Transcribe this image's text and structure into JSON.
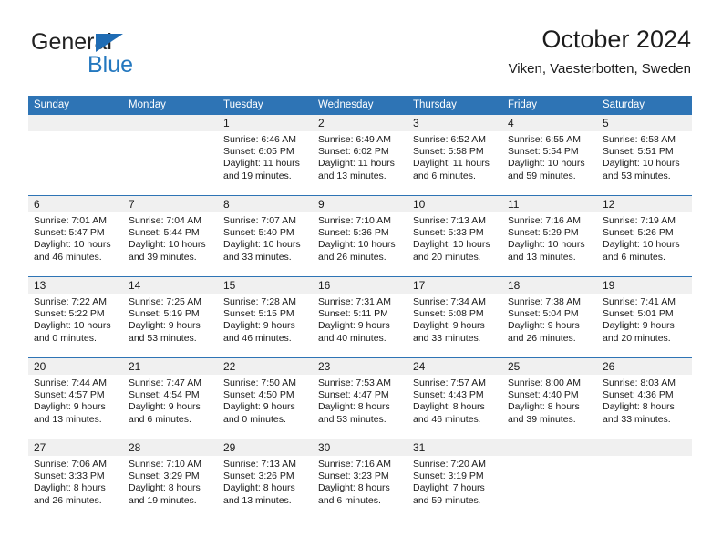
{
  "brand": {
    "name_part1": "General",
    "name_part2": "Blue",
    "accent_color": "#2478bf",
    "triangle_color": "#1f6cb4"
  },
  "header": {
    "title": "October 2024",
    "subtitle": "Viken, Vaesterbotten, Sweden"
  },
  "theme": {
    "header_row_bg": "#2e74b5",
    "daynum_band_bg": "#f0f0f0",
    "grid_line": "#2e74b5",
    "text": "#1a1a1a"
  },
  "calendar": {
    "weekday_headers": [
      "Sunday",
      "Monday",
      "Tuesday",
      "Wednesday",
      "Thursday",
      "Friday",
      "Saturday"
    ],
    "labels": {
      "sunrise": "Sunrise:",
      "sunset": "Sunset:",
      "daylight": "Daylight:"
    },
    "weeks": [
      [
        {
          "day": "",
          "empty": true
        },
        {
          "day": "",
          "empty": true
        },
        {
          "day": "1",
          "sunrise": "Sunrise: 6:46 AM",
          "sunset": "Sunset: 6:05 PM",
          "daylight_1": "Daylight: 11 hours",
          "daylight_2": "and 19 minutes."
        },
        {
          "day": "2",
          "sunrise": "Sunrise: 6:49 AM",
          "sunset": "Sunset: 6:02 PM",
          "daylight_1": "Daylight: 11 hours",
          "daylight_2": "and 13 minutes."
        },
        {
          "day": "3",
          "sunrise": "Sunrise: 6:52 AM",
          "sunset": "Sunset: 5:58 PM",
          "daylight_1": "Daylight: 11 hours",
          "daylight_2": "and 6 minutes."
        },
        {
          "day": "4",
          "sunrise": "Sunrise: 6:55 AM",
          "sunset": "Sunset: 5:54 PM",
          "daylight_1": "Daylight: 10 hours",
          "daylight_2": "and 59 minutes."
        },
        {
          "day": "5",
          "sunrise": "Sunrise: 6:58 AM",
          "sunset": "Sunset: 5:51 PM",
          "daylight_1": "Daylight: 10 hours",
          "daylight_2": "and 53 minutes."
        }
      ],
      [
        {
          "day": "6",
          "sunrise": "Sunrise: 7:01 AM",
          "sunset": "Sunset: 5:47 PM",
          "daylight_1": "Daylight: 10 hours",
          "daylight_2": "and 46 minutes."
        },
        {
          "day": "7",
          "sunrise": "Sunrise: 7:04 AM",
          "sunset": "Sunset: 5:44 PM",
          "daylight_1": "Daylight: 10 hours",
          "daylight_2": "and 39 minutes."
        },
        {
          "day": "8",
          "sunrise": "Sunrise: 7:07 AM",
          "sunset": "Sunset: 5:40 PM",
          "daylight_1": "Daylight: 10 hours",
          "daylight_2": "and 33 minutes."
        },
        {
          "day": "9",
          "sunrise": "Sunrise: 7:10 AM",
          "sunset": "Sunset: 5:36 PM",
          "daylight_1": "Daylight: 10 hours",
          "daylight_2": "and 26 minutes."
        },
        {
          "day": "10",
          "sunrise": "Sunrise: 7:13 AM",
          "sunset": "Sunset: 5:33 PM",
          "daylight_1": "Daylight: 10 hours",
          "daylight_2": "and 20 minutes."
        },
        {
          "day": "11",
          "sunrise": "Sunrise: 7:16 AM",
          "sunset": "Sunset: 5:29 PM",
          "daylight_1": "Daylight: 10 hours",
          "daylight_2": "and 13 minutes."
        },
        {
          "day": "12",
          "sunrise": "Sunrise: 7:19 AM",
          "sunset": "Sunset: 5:26 PM",
          "daylight_1": "Daylight: 10 hours",
          "daylight_2": "and 6 minutes."
        }
      ],
      [
        {
          "day": "13",
          "sunrise": "Sunrise: 7:22 AM",
          "sunset": "Sunset: 5:22 PM",
          "daylight_1": "Daylight: 10 hours",
          "daylight_2": "and 0 minutes."
        },
        {
          "day": "14",
          "sunrise": "Sunrise: 7:25 AM",
          "sunset": "Sunset: 5:19 PM",
          "daylight_1": "Daylight: 9 hours",
          "daylight_2": "and 53 minutes."
        },
        {
          "day": "15",
          "sunrise": "Sunrise: 7:28 AM",
          "sunset": "Sunset: 5:15 PM",
          "daylight_1": "Daylight: 9 hours",
          "daylight_2": "and 46 minutes."
        },
        {
          "day": "16",
          "sunrise": "Sunrise: 7:31 AM",
          "sunset": "Sunset: 5:11 PM",
          "daylight_1": "Daylight: 9 hours",
          "daylight_2": "and 40 minutes."
        },
        {
          "day": "17",
          "sunrise": "Sunrise: 7:34 AM",
          "sunset": "Sunset: 5:08 PM",
          "daylight_1": "Daylight: 9 hours",
          "daylight_2": "and 33 minutes."
        },
        {
          "day": "18",
          "sunrise": "Sunrise: 7:38 AM",
          "sunset": "Sunset: 5:04 PM",
          "daylight_1": "Daylight: 9 hours",
          "daylight_2": "and 26 minutes."
        },
        {
          "day": "19",
          "sunrise": "Sunrise: 7:41 AM",
          "sunset": "Sunset: 5:01 PM",
          "daylight_1": "Daylight: 9 hours",
          "daylight_2": "and 20 minutes."
        }
      ],
      [
        {
          "day": "20",
          "sunrise": "Sunrise: 7:44 AM",
          "sunset": "Sunset: 4:57 PM",
          "daylight_1": "Daylight: 9 hours",
          "daylight_2": "and 13 minutes."
        },
        {
          "day": "21",
          "sunrise": "Sunrise: 7:47 AM",
          "sunset": "Sunset: 4:54 PM",
          "daylight_1": "Daylight: 9 hours",
          "daylight_2": "and 6 minutes."
        },
        {
          "day": "22",
          "sunrise": "Sunrise: 7:50 AM",
          "sunset": "Sunset: 4:50 PM",
          "daylight_1": "Daylight: 9 hours",
          "daylight_2": "and 0 minutes."
        },
        {
          "day": "23",
          "sunrise": "Sunrise: 7:53 AM",
          "sunset": "Sunset: 4:47 PM",
          "daylight_1": "Daylight: 8 hours",
          "daylight_2": "and 53 minutes."
        },
        {
          "day": "24",
          "sunrise": "Sunrise: 7:57 AM",
          "sunset": "Sunset: 4:43 PM",
          "daylight_1": "Daylight: 8 hours",
          "daylight_2": "and 46 minutes."
        },
        {
          "day": "25",
          "sunrise": "Sunrise: 8:00 AM",
          "sunset": "Sunset: 4:40 PM",
          "daylight_1": "Daylight: 8 hours",
          "daylight_2": "and 39 minutes."
        },
        {
          "day": "26",
          "sunrise": "Sunrise: 8:03 AM",
          "sunset": "Sunset: 4:36 PM",
          "daylight_1": "Daylight: 8 hours",
          "daylight_2": "and 33 minutes."
        }
      ],
      [
        {
          "day": "27",
          "sunrise": "Sunrise: 7:06 AM",
          "sunset": "Sunset: 3:33 PM",
          "daylight_1": "Daylight: 8 hours",
          "daylight_2": "and 26 minutes."
        },
        {
          "day": "28",
          "sunrise": "Sunrise: 7:10 AM",
          "sunset": "Sunset: 3:29 PM",
          "daylight_1": "Daylight: 8 hours",
          "daylight_2": "and 19 minutes."
        },
        {
          "day": "29",
          "sunrise": "Sunrise: 7:13 AM",
          "sunset": "Sunset: 3:26 PM",
          "daylight_1": "Daylight: 8 hours",
          "daylight_2": "and 13 minutes."
        },
        {
          "day": "30",
          "sunrise": "Sunrise: 7:16 AM",
          "sunset": "Sunset: 3:23 PM",
          "daylight_1": "Daylight: 8 hours",
          "daylight_2": "and 6 minutes."
        },
        {
          "day": "31",
          "sunrise": "Sunrise: 7:20 AM",
          "sunset": "Sunset: 3:19 PM",
          "daylight_1": "Daylight: 7 hours",
          "daylight_2": "and 59 minutes."
        },
        {
          "day": "",
          "empty": true
        },
        {
          "day": "",
          "empty": true
        }
      ]
    ]
  }
}
